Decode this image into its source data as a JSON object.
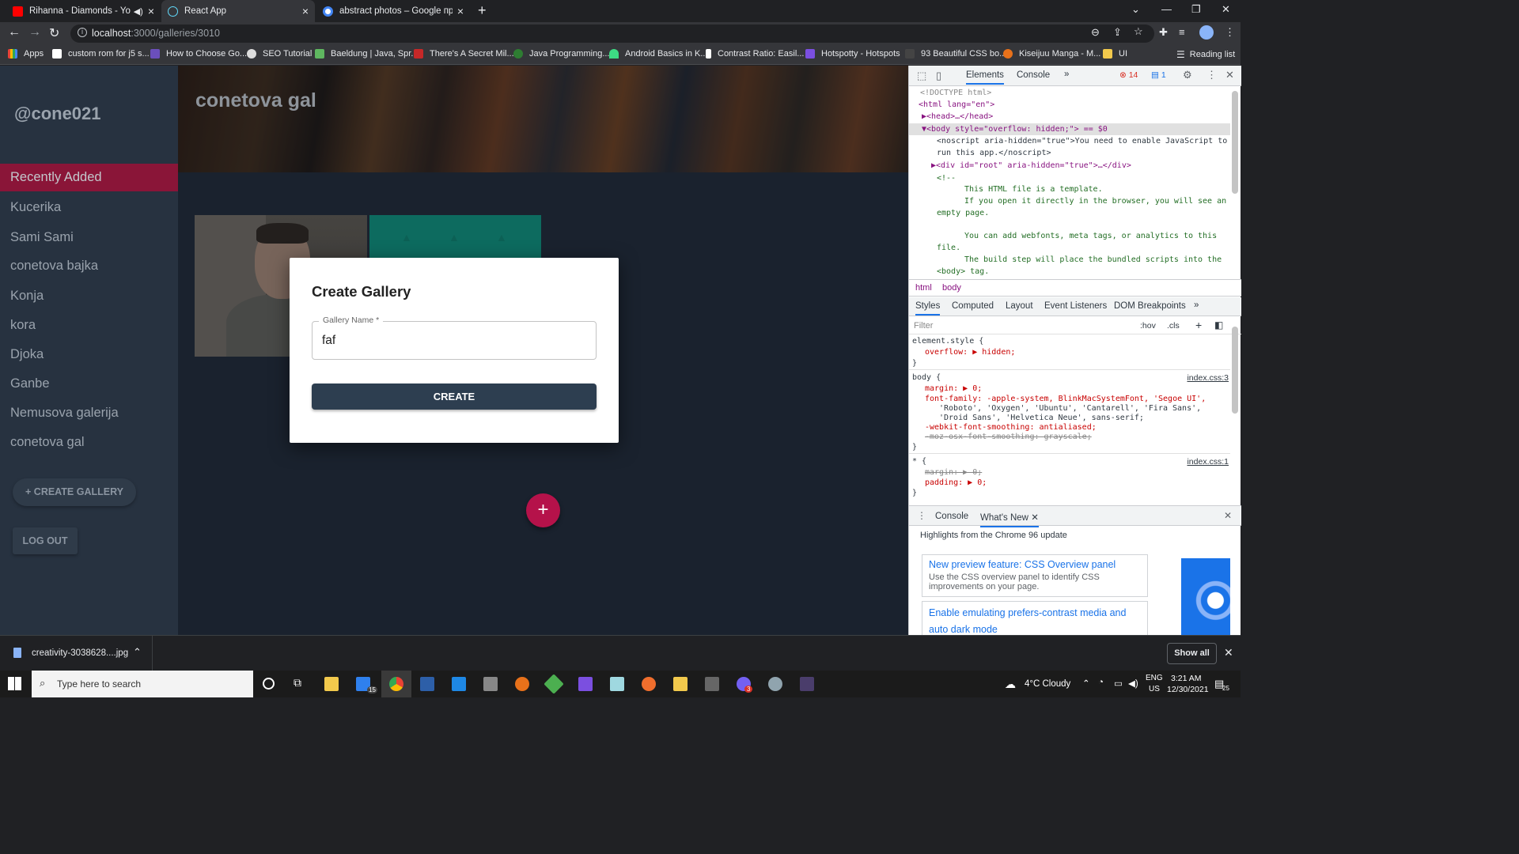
{
  "browser": {
    "tabs": [
      {
        "title": "Rihanna - Diamonds - YouTu",
        "muted_icon": "speaker-icon",
        "close": "×",
        "favicon_color": "#ff0000"
      },
      {
        "title": "React App",
        "close": "×",
        "favicon_color": "#61dafb"
      },
      {
        "title": "abstract photos – Google претра",
        "close": "×",
        "favicon_color": "#4285f4"
      }
    ],
    "new_tab": "+",
    "url_host": "localhost",
    "url_path": ":3000/galleries/3010",
    "bookmarks": [
      "Apps",
      "custom rom for j5 s...",
      "How to Choose Go...",
      "SEO Tutorial",
      "Baeldung | Java, Spr...",
      "There's A Secret Mil...",
      "Java Programming...",
      "Android Basics in K...",
      "Contrast Ratio: Easil...",
      "Hotspotty - Hotspots",
      "93 Beautiful CSS bo...",
      "Kiseijuu Manga - M...",
      "UI"
    ],
    "reading_list": "Reading list"
  },
  "app": {
    "username": "@cone021",
    "galleries": [
      "Recently Added",
      "Kucerika",
      "Sami Sami",
      "conetova bajka",
      "Konja",
      "kora",
      "Djoka",
      "Ganbe",
      "Nemusova galerija",
      "conetova gal"
    ],
    "active_gallery": "Recently Added",
    "create_gallery_label": "+ CREATE GALLERY",
    "logout_label": "LOG OUT",
    "banner_title": "conetova gal",
    "fab_label": "+",
    "dialog": {
      "title": "Create Gallery",
      "field_label": "Gallery Name *",
      "field_value": "faf",
      "submit_label": "CREATE"
    }
  },
  "devtools": {
    "tabs": [
      "Elements",
      "Console",
      "»"
    ],
    "error_count": "14",
    "message_count": "1",
    "dom_lines": [
      "<!DOCTYPE html>",
      "<html lang=\"en\">",
      "▶<head>…</head>",
      "▼<body style=\"overflow: hidden;\"> == $0",
      "<noscript aria-hidden=\"true\">You need to enable JavaScript to",
      "run this app.</noscript>",
      "▶<div id=\"root\" aria-hidden=\"true\">…</div>",
      "<!--",
      "This HTML file is a template.",
      "If you open it directly in the browser, you will see an",
      "empty page.",
      "You can add webfonts, meta tags, or analytics to this",
      "file.",
      "The build step will place the bundled scripts into the",
      "<body> tag."
    ],
    "crumbs": [
      "html",
      "body"
    ],
    "style_tabs": [
      "Styles",
      "Computed",
      "Layout",
      "Event Listeners",
      "DOM Breakpoints",
      "»"
    ],
    "filter_placeholder": "Filter",
    "filter_tools": [
      ":hov",
      ".cls",
      "+"
    ],
    "rules": {
      "element_style": "element.style {",
      "overflow": "overflow: ▶ hidden;",
      "close": "}",
      "body_selector": "body {",
      "body_source": "index.css:3",
      "margin": "margin: ▶ 0;",
      "font_family_1": "font-family: -apple-system, BlinkMacSystemFont, 'Segoe UI',",
      "font_family_2": "'Roboto', 'Oxygen', 'Ubuntu', 'Cantarell', 'Fira Sans',",
      "font_family_3": "'Droid Sans', 'Helvetica Neue', sans-serif;",
      "smoothing": "-webkit-font-smoothing: antialiased;",
      "moz_smoothing": "-moz-osx-font-smoothing: grayscale;",
      "star_selector": "* {",
      "star_source": "index.css:1",
      "star_margin": "margin: ▶ 0;",
      "star_padding": "padding: ▶ 0;"
    },
    "drawer_tabs": [
      "Console",
      "What's New"
    ],
    "drawer_heading": "Highlights from the Chrome 96 update",
    "cards": [
      {
        "title": "New preview feature: CSS Overview panel",
        "desc": "Use the CSS overview panel to identify CSS improvements on your page."
      },
      {
        "title": "Enable emulating prefers-contrast media and auto dark mode",
        "desc": ""
      }
    ]
  },
  "download": {
    "filename": "creativity-3038628....jpg",
    "show_all": "Show all"
  },
  "taskbar": {
    "search_placeholder": "Type here to search",
    "mail_badge": "15",
    "viber_badge": "3",
    "weather": "4°C  Cloudy",
    "lang": "ENG",
    "region": "US",
    "time": "3:21 AM",
    "date": "12/30/2021",
    "notif_badge": "25"
  }
}
